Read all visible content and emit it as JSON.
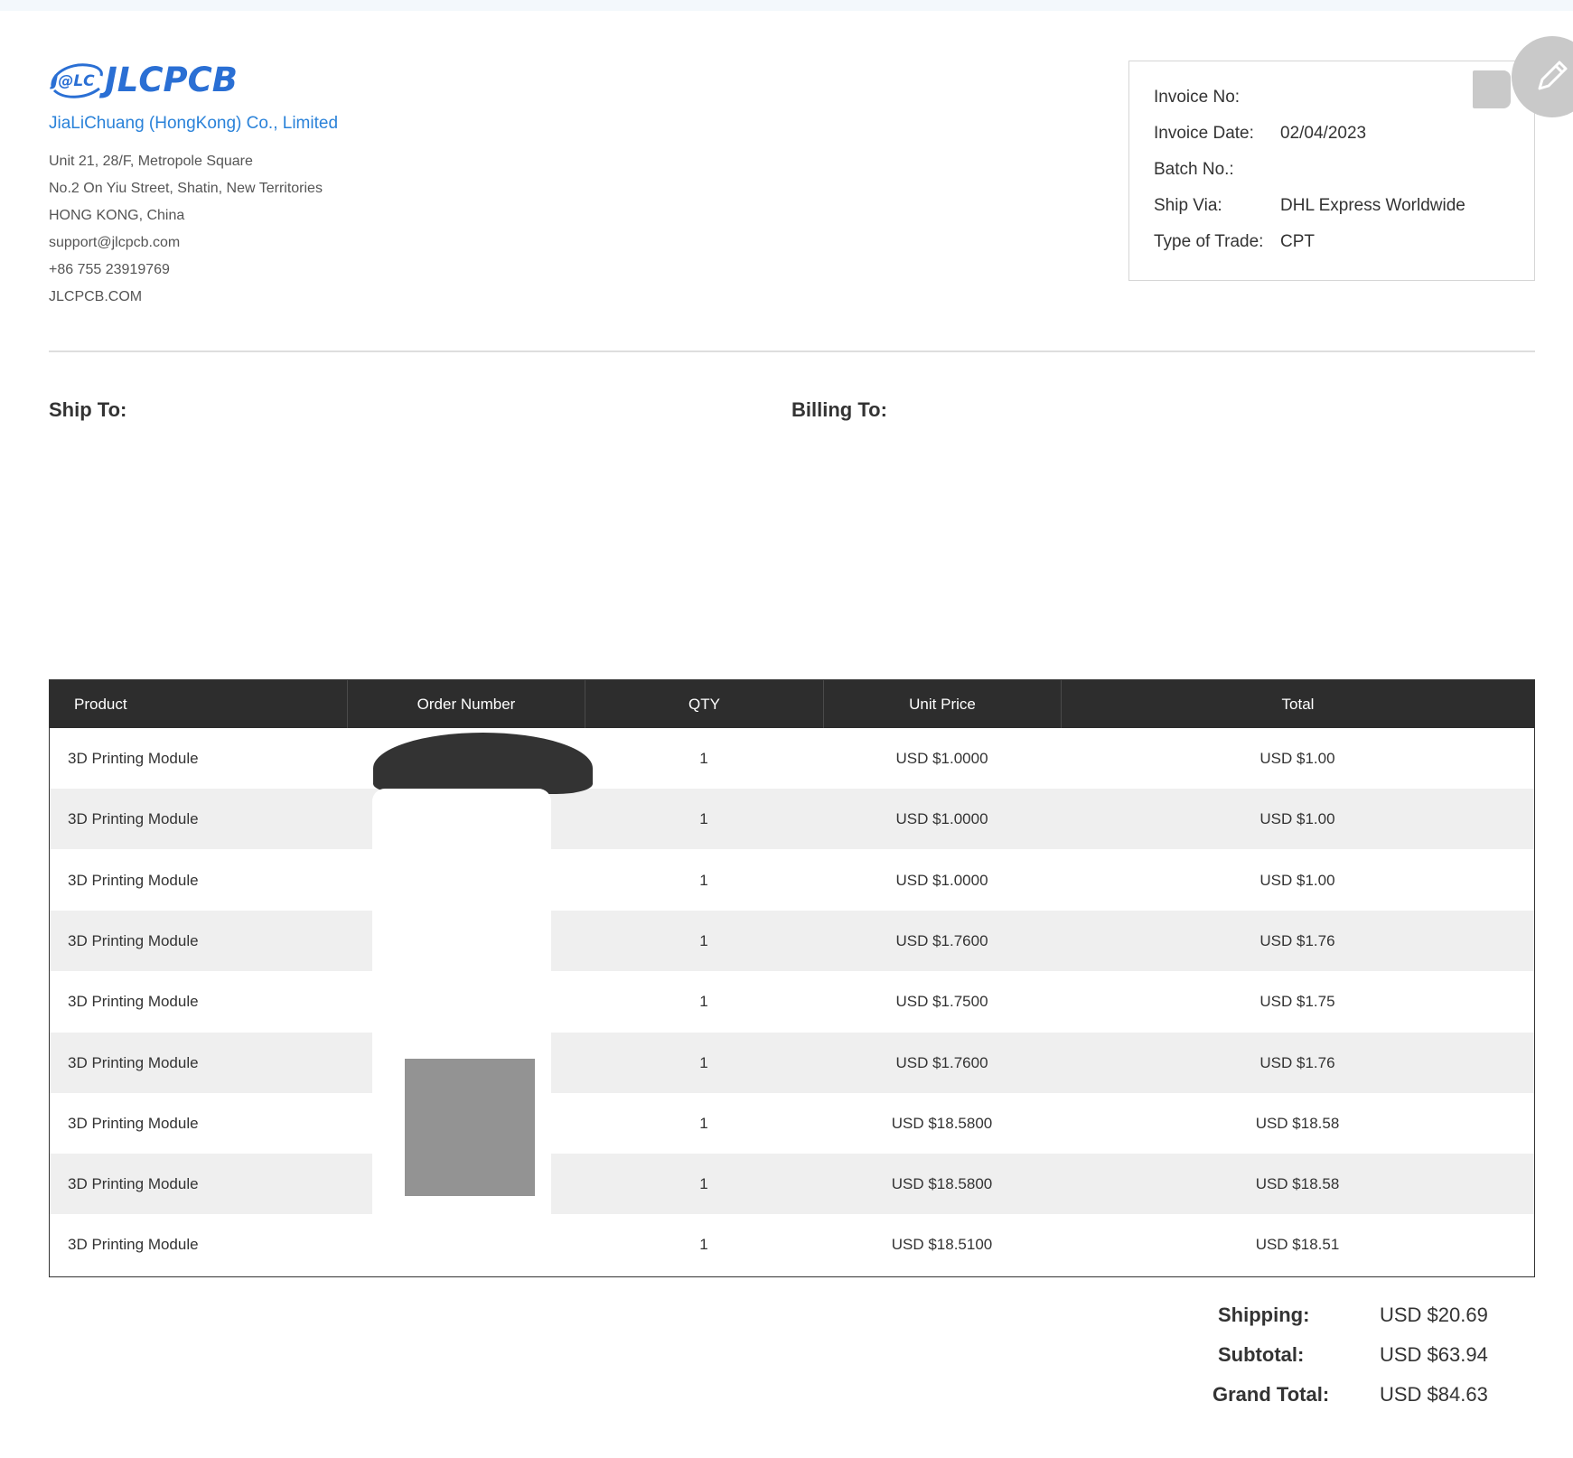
{
  "company": {
    "logo_mark": "J@LC",
    "logo_text": "JLCPCB",
    "name": "JiaLiChuang (HongKong) Co., Limited",
    "address_lines": [
      "Unit 21, 28/F, Metropole Square",
      "No.2 On Yiu Street, Shatin, New Territories",
      "HONG KONG, China",
      "support@jlcpcb.com",
      "+86 755 23919769",
      "JLCPCB.COM"
    ]
  },
  "invoice": {
    "invoice_no_label": "Invoice No:",
    "invoice_no": "",
    "date_label": "Invoice Date:",
    "date": "02/04/2023",
    "batch_label": "Batch No.:",
    "batch": "",
    "ship_via_label": "Ship Via:",
    "ship_via": "DHL Express Worldwide",
    "trade_label": "Type of Trade:",
    "trade": "CPT"
  },
  "addresses": {
    "ship_to_label": "Ship To:",
    "billing_to_label": "Billing To:"
  },
  "table": {
    "headers": [
      "Product",
      "Order Number",
      "QTY",
      "Unit Price",
      "Total"
    ],
    "rows": [
      {
        "product": "3D Printing Module",
        "order": "",
        "qty": "1",
        "unit": "USD $1.0000",
        "total": "USD $1.00"
      },
      {
        "product": "3D Printing Module",
        "order": "",
        "qty": "1",
        "unit": "USD $1.0000",
        "total": "USD $1.00"
      },
      {
        "product": "3D Printing Module",
        "order": "",
        "qty": "1",
        "unit": "USD $1.0000",
        "total": "USD $1.00"
      },
      {
        "product": "3D Printing Module",
        "order": "",
        "qty": "1",
        "unit": "USD $1.7600",
        "total": "USD $1.76"
      },
      {
        "product": "3D Printing Module",
        "order": "",
        "qty": "1",
        "unit": "USD $1.7500",
        "total": "USD $1.75"
      },
      {
        "product": "3D Printing Module",
        "order": "",
        "qty": "1",
        "unit": "USD $1.7600",
        "total": "USD $1.76"
      },
      {
        "product": "3D Printing Module",
        "order": "",
        "qty": "1",
        "unit": "USD $18.5800",
        "total": "USD $18.58"
      },
      {
        "product": "3D Printing Module",
        "order": "",
        "qty": "1",
        "unit": "USD $18.5800",
        "total": "USD $18.58"
      },
      {
        "product": "3D Printing Module",
        "order": "",
        "qty": "1",
        "unit": "USD $18.5100",
        "total": "USD $18.51"
      }
    ]
  },
  "totals": {
    "shipping_label": "Shipping:",
    "shipping": "USD $20.69",
    "subtotal_label": "Subtotal:",
    "subtotal": "USD $63.94",
    "grand_label": "Grand Total:",
    "grand": "USD $84.63"
  },
  "icons": {
    "edit": "pencil-icon"
  },
  "colors": {
    "brand": "#2a6fd4",
    "company_name": "#2a82d9",
    "table_header": "#2d2d2d",
    "row_alt": "#efefef"
  }
}
